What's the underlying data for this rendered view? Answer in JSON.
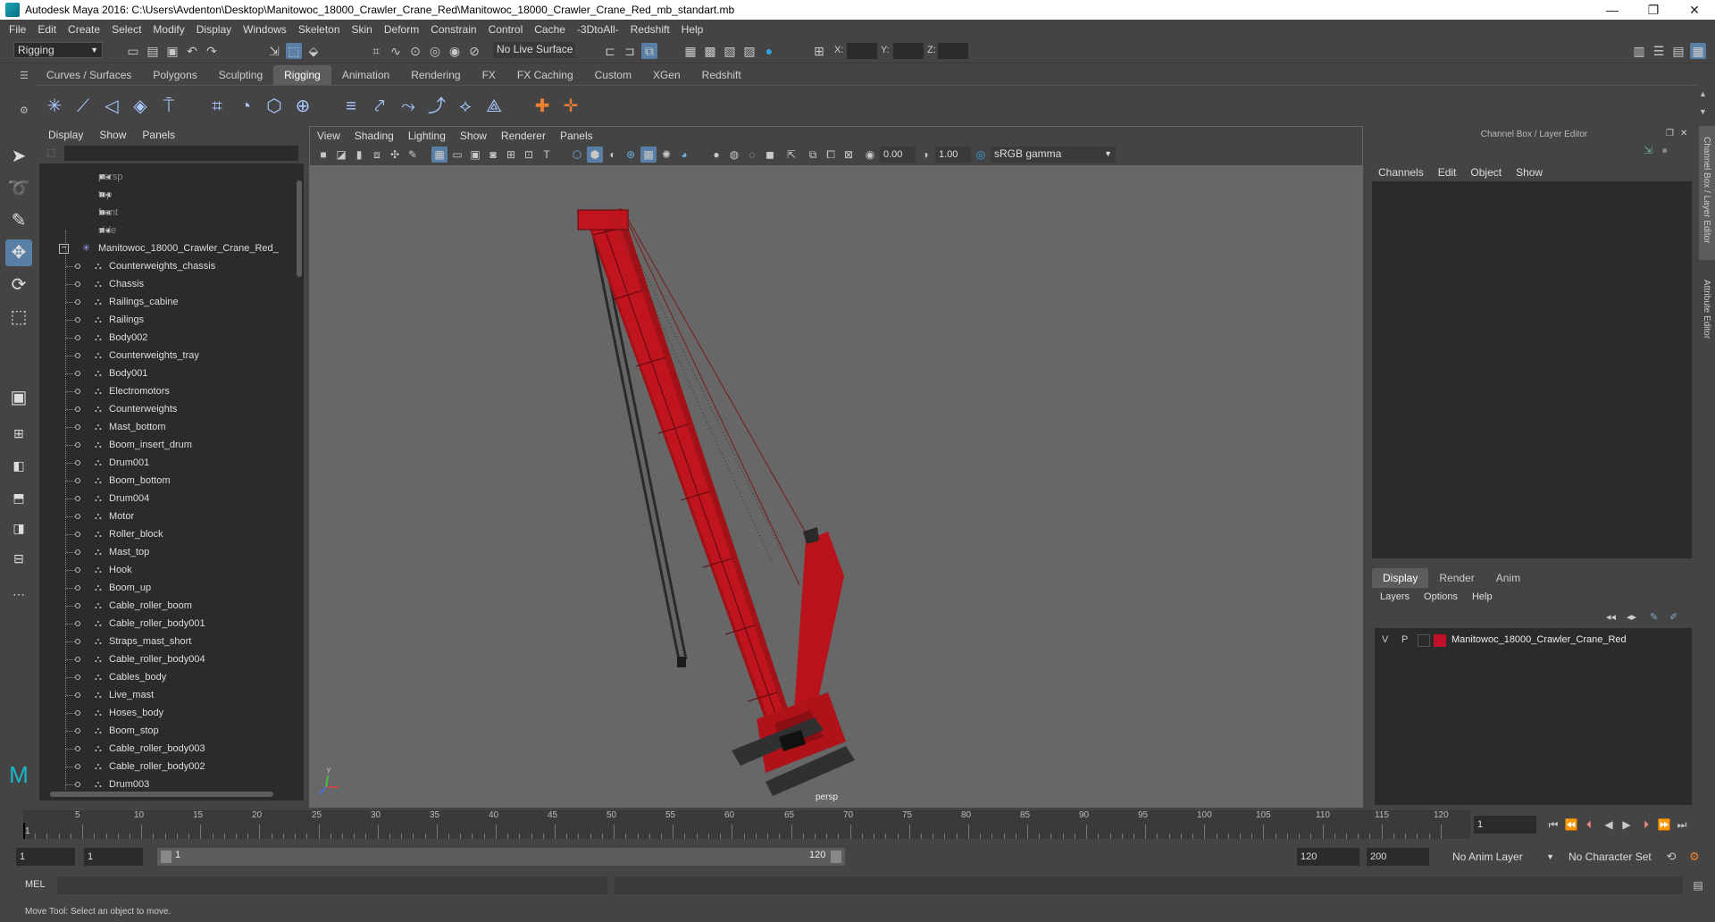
{
  "window": {
    "title": "Autodesk Maya 2016: C:\\Users\\Avdenton\\Desktop\\Manitowoc_18000_Crawler_Crane_Red\\Manitowoc_18000_Crawler_Crane_Red_mb_standart.mb",
    "minimize": "—",
    "maximize": "❐",
    "close": "✕"
  },
  "menubar": [
    "File",
    "Edit",
    "Create",
    "Select",
    "Modify",
    "Display",
    "Windows",
    "Skeleton",
    "Skin",
    "Deform",
    "Constrain",
    "Control",
    "Cache",
    "-3DtoAll-",
    "Redshift",
    "Help"
  ],
  "statusline": {
    "mode": "Rigging",
    "live_surface": "No Live Surface",
    "x_label": "X:",
    "y_label": "Y:",
    "z_label": "Z:"
  },
  "shelf_tabs": [
    "Curves / Surfaces",
    "Polygons",
    "Sculpting",
    "Rigging",
    "Animation",
    "Rendering",
    "FX",
    "FX Caching",
    "Custom",
    "XGen",
    "Redshift"
  ],
  "shelf_selected": "Rigging",
  "outliner": {
    "menu": [
      "Display",
      "Show",
      "Panels"
    ],
    "cameras": [
      "persp",
      "top",
      "front",
      "side"
    ],
    "root": "Manitowoc_18000_Crawler_Crane_Red_",
    "children": [
      "Counterweights_chassis",
      "Chassis",
      "Railings_cabine",
      "Railings",
      "Body002",
      "Counterweights_tray",
      "Body001",
      "Electromotors",
      "Counterweights",
      "Mast_bottom",
      "Boom_insert_drum",
      "Drum001",
      "Boom_bottom",
      "Drum004",
      "Motor",
      "Roller_block",
      "Mast_top",
      "Hook",
      "Boom_up",
      "Cable_roller_boom",
      "Cable_roller_body001",
      "Straps_mast_short",
      "Cable_roller_body004",
      "Cables_body",
      "Live_mast",
      "Hoses_body",
      "Boom_stop",
      "Cable_roller_body003",
      "Cable_roller_body002",
      "Drum003"
    ]
  },
  "viewport": {
    "menu": [
      "View",
      "Shading",
      "Lighting",
      "Show",
      "Renderer",
      "Panels"
    ],
    "exposure": "0.00",
    "gamma": "1.00",
    "colorspace": "sRGB gamma",
    "camera_label": "persp"
  },
  "channel_box": {
    "title": "Channel Box / Layer Editor",
    "menu": [
      "Channels",
      "Edit",
      "Object",
      "Show"
    ]
  },
  "layer_editor": {
    "tabs": [
      "Display",
      "Render",
      "Anim"
    ],
    "selected_tab": "Display",
    "menu": [
      "Layers",
      "Options",
      "Help"
    ],
    "layer": {
      "v": "V",
      "p": "P",
      "name": "Manitowoc_18000_Crawler_Crane_Red",
      "color": "#c0102a"
    }
  },
  "side_tabs": [
    "Channel Box / Layer Editor",
    "Attribute Editor"
  ],
  "timeline": {
    "ticks": [
      5,
      10,
      15,
      20,
      25,
      30,
      35,
      40,
      45,
      50,
      55,
      60,
      65,
      70,
      75,
      80,
      85,
      90,
      95,
      100,
      105,
      110,
      115,
      120
    ],
    "start_marker": "1",
    "current_frame": "1"
  },
  "range": {
    "start": "1",
    "playback_start": "1",
    "slider_start": "1",
    "slider_end": "120",
    "playback_end": "120",
    "end": "200",
    "anim_layer": "No Anim Layer",
    "character_set": "No Character Set"
  },
  "mel": {
    "label": "MEL"
  },
  "help_line": "Move Tool: Select an object to move.",
  "colors": {
    "accent": "#5a7fa6",
    "crane": "#c0141e",
    "layer_color": "#c0102a"
  }
}
